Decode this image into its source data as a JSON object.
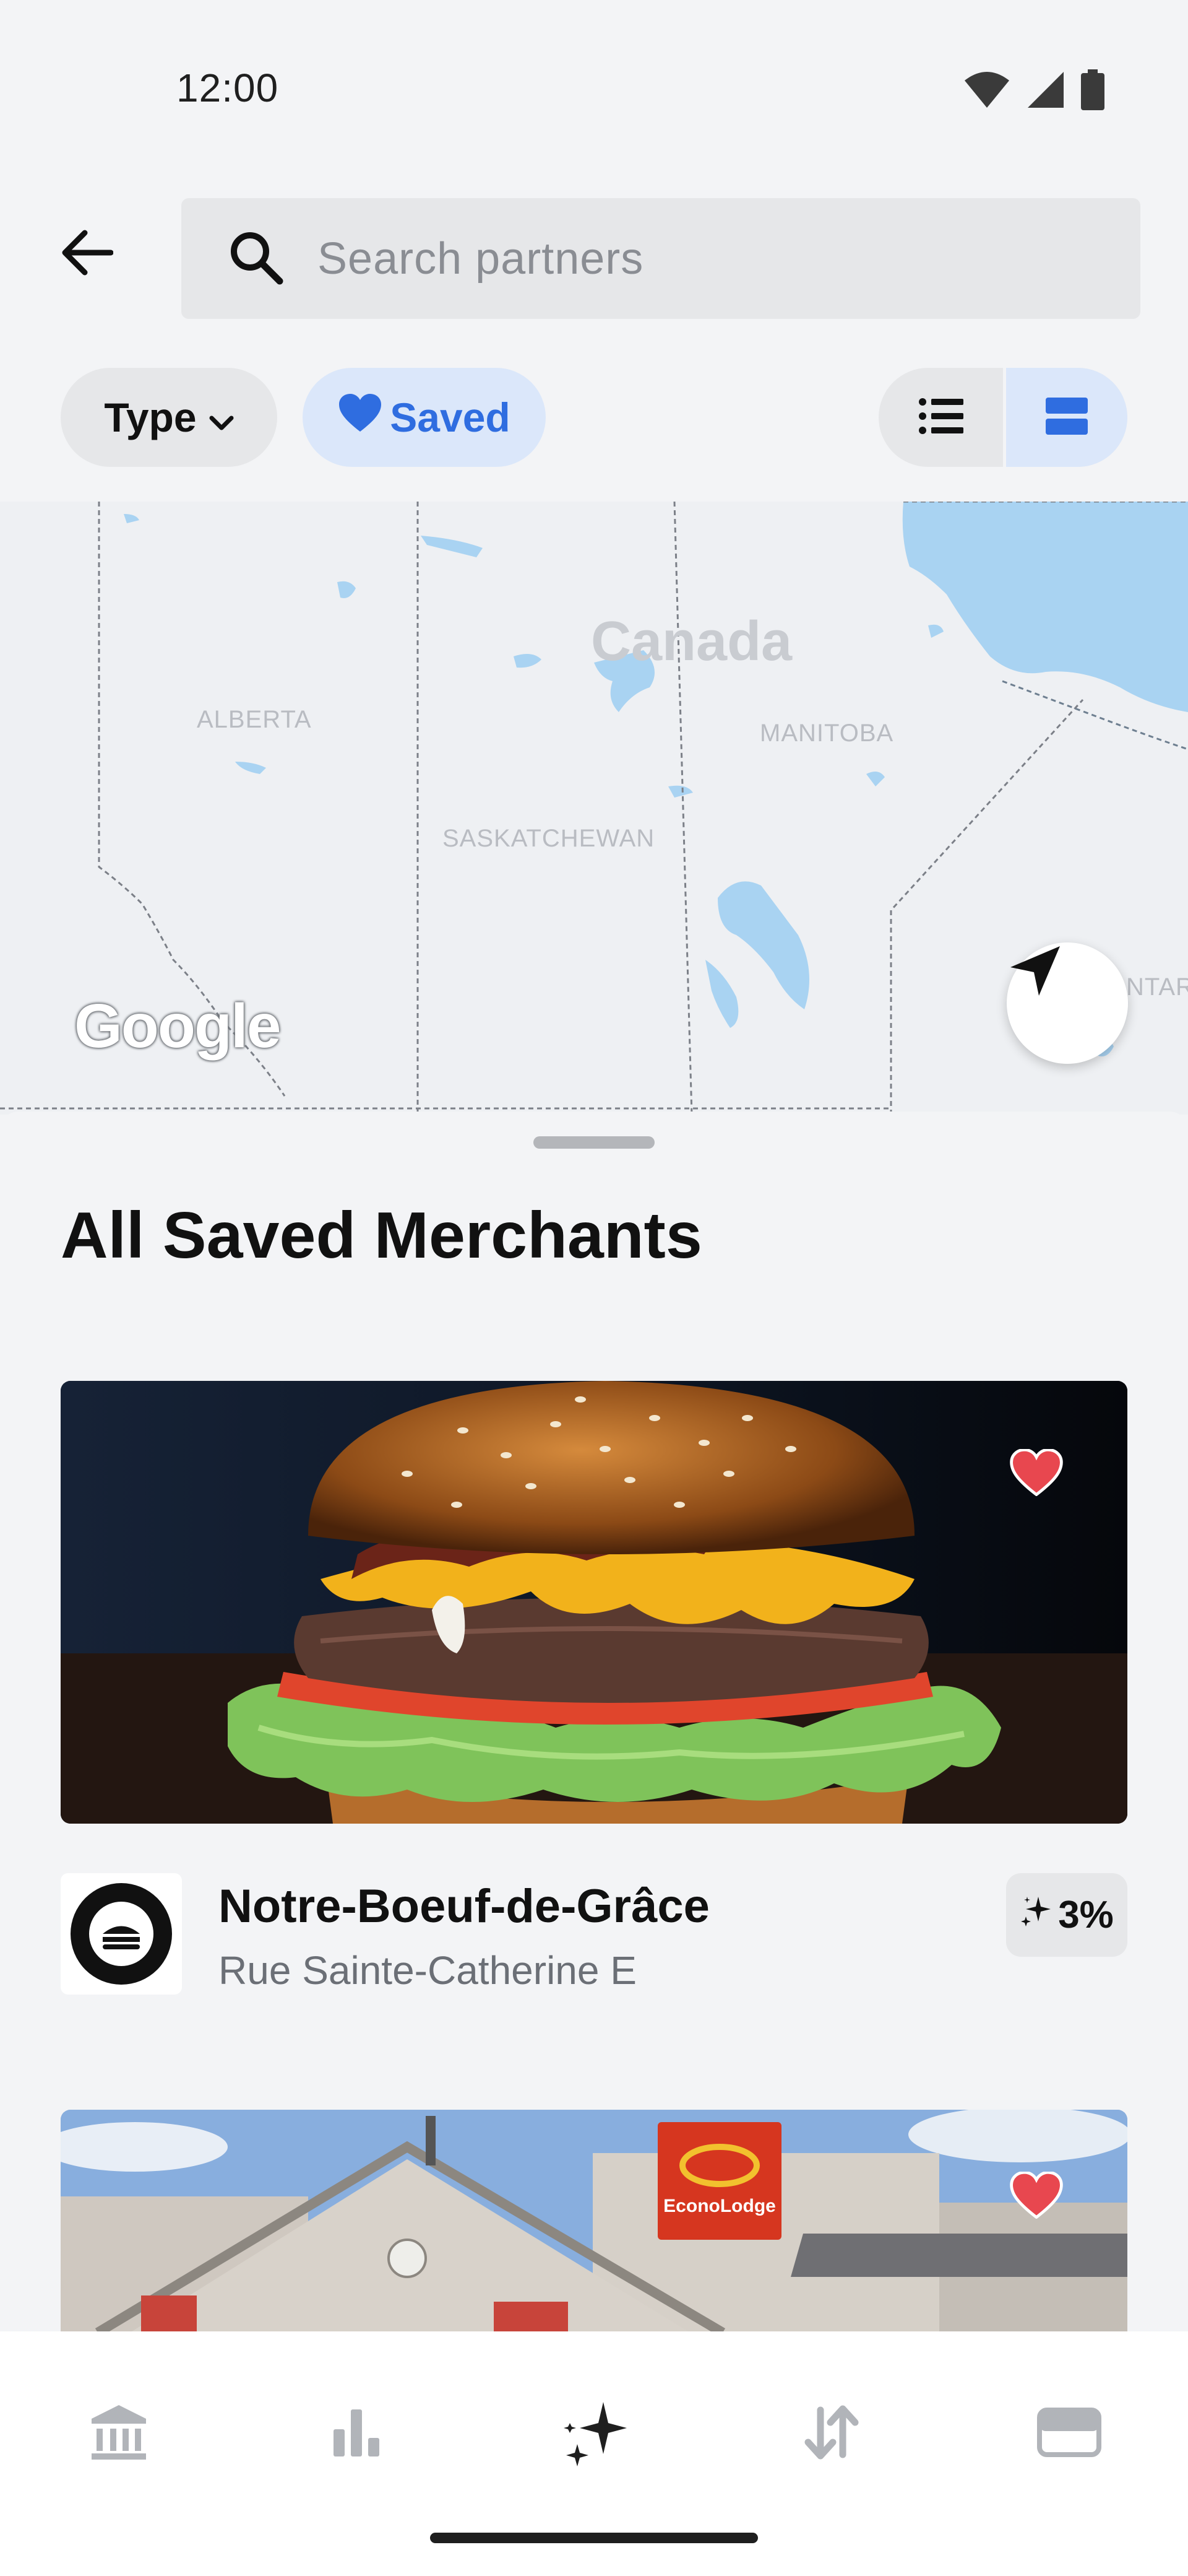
{
  "status_bar": {
    "time": "12:00",
    "icons": [
      "wifi-icon",
      "cellular-signal-icon",
      "battery-icon"
    ]
  },
  "header": {
    "back_icon": "arrow-left-icon",
    "search": {
      "icon": "search-icon",
      "placeholder": "Search partners",
      "value": ""
    }
  },
  "filters": {
    "type_chip": {
      "label": "Type",
      "icon": "chevron-down-icon"
    },
    "saved_chip": {
      "label": "Saved",
      "icon": "heart-icon",
      "selected": true
    },
    "view_toggle": {
      "options": [
        {
          "name": "list-view",
          "icon": "list-icon",
          "selected": false
        },
        {
          "name": "card-view",
          "icon": "cards-icon",
          "selected": true
        }
      ]
    }
  },
  "map": {
    "country_label": "Canada",
    "region_labels": [
      "ALBERTA",
      "MANITOBA",
      "SASKATCHEWAN",
      "NTAR"
    ],
    "attribution": "Google",
    "locate_icon": "navigation-arrow-icon"
  },
  "sheet": {
    "title": "All Saved Merchants",
    "merchants": [
      {
        "name": "Notre-Boeuf-de-Grâce",
        "address": "Rue Sainte-Catherine E",
        "cashback": "3%",
        "saved": true,
        "image": "burger-photo",
        "logo": "notre-boeuf-de-grace-logo"
      },
      {
        "name": "",
        "address": "",
        "saved": true,
        "image": "econolodge-hotel-photo",
        "sign_text": "EconoLodge"
      }
    ]
  },
  "bottom_nav": {
    "items": [
      {
        "name": "nav-bank",
        "icon": "bank-icon",
        "active": false
      },
      {
        "name": "nav-insights",
        "icon": "bar-chart-icon",
        "active": false
      },
      {
        "name": "nav-rewards",
        "icon": "sparkle-icon",
        "active": true
      },
      {
        "name": "nav-transfers",
        "icon": "transfer-arrows-icon",
        "active": false
      },
      {
        "name": "nav-cards",
        "icon": "card-icon",
        "active": false
      }
    ]
  },
  "colors": {
    "background": "#f3f4f6",
    "accent": "#2f6de0",
    "accent_light": "#dbe7fa",
    "chip_gray": "#e6e7e9",
    "heart": "#e8474f",
    "water": "#a9d3f2"
  }
}
